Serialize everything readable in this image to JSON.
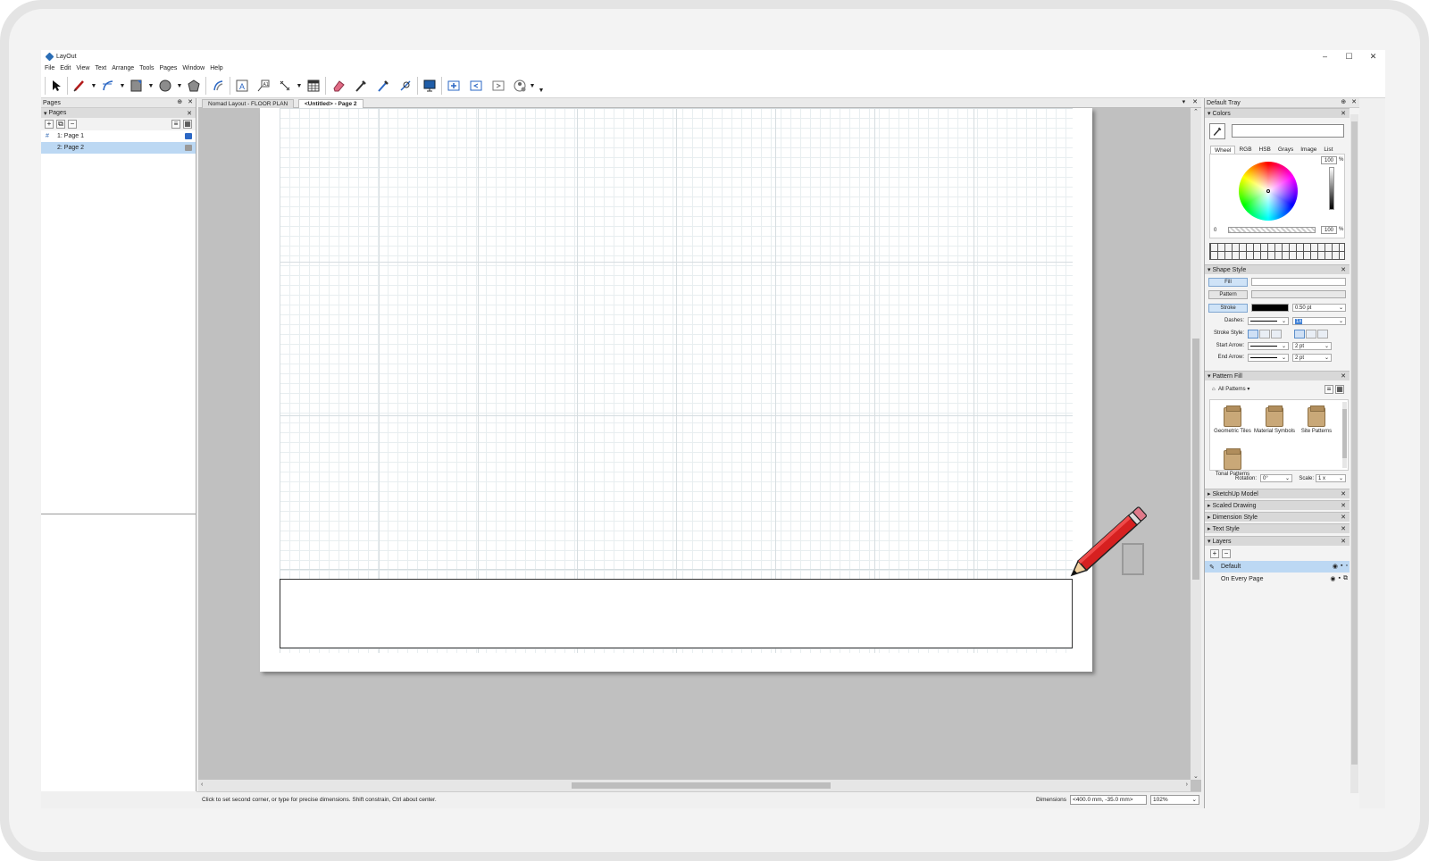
{
  "window": {
    "title": "LayOut",
    "controls": [
      "–",
      "☐",
      "✕"
    ]
  },
  "menu": [
    "File",
    "Edit",
    "View",
    "Text",
    "Arrange",
    "Tools",
    "Pages",
    "Window",
    "Help"
  ],
  "pages_panel": {
    "title": "Pages",
    "section": "Pages",
    "pin": "⊕",
    "close": "✕",
    "add": "+",
    "duplicate": "⧉",
    "remove": "−",
    "items": [
      {
        "label": "1: Page 1",
        "selected": false,
        "color": "#2b67c4"
      },
      {
        "label": "2: Page 2",
        "selected": true,
        "color": "#888888"
      }
    ]
  },
  "document": {
    "tabs": [
      "Nomad Layout - FLOOR PLAN",
      "<Untitled> - Page 2"
    ],
    "active_tab": 1,
    "tab_controls": [
      "▾",
      "✕"
    ]
  },
  "statusbar": {
    "message": "Click to set second corner, or type for precise dimensions. Shift constrain, Ctrl about center.",
    "dimensions_label": "Dimensions",
    "dimensions_value": "<400.0 mm, -35.0 mm>",
    "zoom": "102%"
  },
  "tray": {
    "title": "Default Tray",
    "colors": {
      "title": "Colors",
      "tabs": [
        "Wheel",
        "RGB",
        "HSB",
        "Grays",
        "Image",
        "List"
      ],
      "brightness": "100",
      "opacity": "100",
      "opacity_min": "0",
      "unit": "%"
    },
    "shape_style": {
      "title": "Shape Style",
      "fill": "Fill",
      "pattern": "Pattern",
      "stroke": "Stroke",
      "stroke_weight": "0.50 pt",
      "dashes_label": "Dashes:",
      "dash_scale": "1x",
      "stroke_style_label": "Stroke Style:",
      "start_arrow_label": "Start Arrow:",
      "start_arrow_size": "2 pt",
      "end_arrow_label": "End Arrow:",
      "end_arrow_size": "2 pt"
    },
    "pattern_fill": {
      "title": "Pattern Fill",
      "filter": "All Patterns",
      "folders": [
        "Geometric Tiles",
        "Material Symbols",
        "Site Patterns",
        "Tonal Patterns"
      ],
      "rotation_label": "Rotation:",
      "rotation_value": "0°",
      "scale_label": "Scale:",
      "scale_value": "1 x"
    },
    "collapsed_sections": [
      "SketchUp Model",
      "Scaled Drawing",
      "Dimension Style",
      "Text Style"
    ],
    "layers": {
      "title": "Layers",
      "add": "+",
      "remove": "−",
      "items": [
        {
          "label": "Default",
          "selected": true
        },
        {
          "label": "On Every Page",
          "selected": false
        }
      ]
    }
  },
  "colors_accent": {
    "selection": "#bcd8f3",
    "pencil_red": "#d62020",
    "canvas_bg": "#c0c0c0"
  }
}
